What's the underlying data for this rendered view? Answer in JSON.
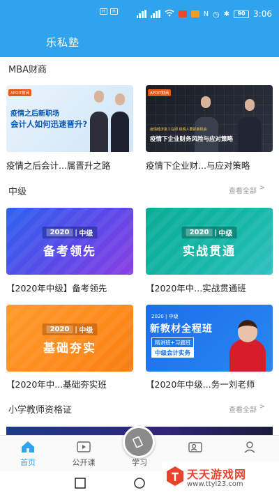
{
  "status": {
    "time": "3:06",
    "battery": "90"
  },
  "app": {
    "title": "乐私塾"
  },
  "sections": {
    "mba": {
      "title": "MBA财商",
      "cards": [
        {
          "caption": "疫情之后会计...属晋升之路",
          "tag": "APOIT财商",
          "line1": "疫情之后新职场",
          "line2": "会计人如何迅速晋升?"
        },
        {
          "caption": "疫情下企业财...与应对策略",
          "tag": "APOIT财商",
          "line1": "疫情经济复工在即 财税人要抓新机会",
          "line2": "疫情下企业财务风险与应对策略"
        }
      ]
    },
    "mid": {
      "title": "中级",
      "see_all": "查看全部",
      "cards": [
        {
          "caption": "【2020年中级】备考领先",
          "year": "2020",
          "level": "中级",
          "name": "备考领先"
        },
        {
          "caption": "【2020年中...实战贯通班",
          "year": "2020",
          "level": "中级",
          "name": "实战贯通"
        },
        {
          "caption": "【2020年中...基础夯实班",
          "year": "2020",
          "level": "中级",
          "name": "基础夯实"
        },
        {
          "caption": "【2020年中级...务一刘老师",
          "year_label": "2020 | 中级",
          "name": "新教材全程班",
          "pill": "精讲班+习题班",
          "pill2": "中级会计实务"
        }
      ]
    },
    "teacher": {
      "title": "小学教师资格证",
      "see_all": "查看全部"
    }
  },
  "tabs": [
    {
      "label": "首页",
      "icon": "home-icon",
      "active": true
    },
    {
      "label": "公开课",
      "icon": "video-icon",
      "active": false
    },
    {
      "label": "学习",
      "icon": "study-icon",
      "active": false
    },
    {
      "label": "",
      "icon": "classmates-icon",
      "active": false
    },
    {
      "label": "",
      "icon": "profile-icon",
      "active": false
    }
  ],
  "watermark": {
    "title": "天天游戏网",
    "url": "www.ttyl23.com"
  },
  "colors": {
    "primary": "#2fa3ee"
  }
}
